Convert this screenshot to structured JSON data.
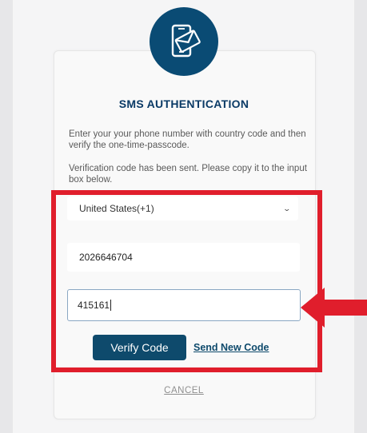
{
  "header": {
    "icon": "sms-envelope-icon",
    "title": "SMS AUTHENTICATION"
  },
  "instructions": "Enter your your phone number with country code and then verify the one-time-passcode.",
  "status_message": "Verification code has been sent. Please copy it to the input box below.",
  "form": {
    "country_value": "United States(+1)",
    "phone_value": "2026646704",
    "code_value": "415161"
  },
  "actions": {
    "verify_label": "Verify Code",
    "send_new_label": "Send New Code",
    "cancel_label": "CANCEL"
  },
  "colors": {
    "brand": "#0a4b74",
    "annotation": "#e01e2c",
    "background": "#e7e7e9"
  },
  "annotations": {
    "highlight": "red-highlight-box",
    "pointer": "red-arrow-icon"
  }
}
